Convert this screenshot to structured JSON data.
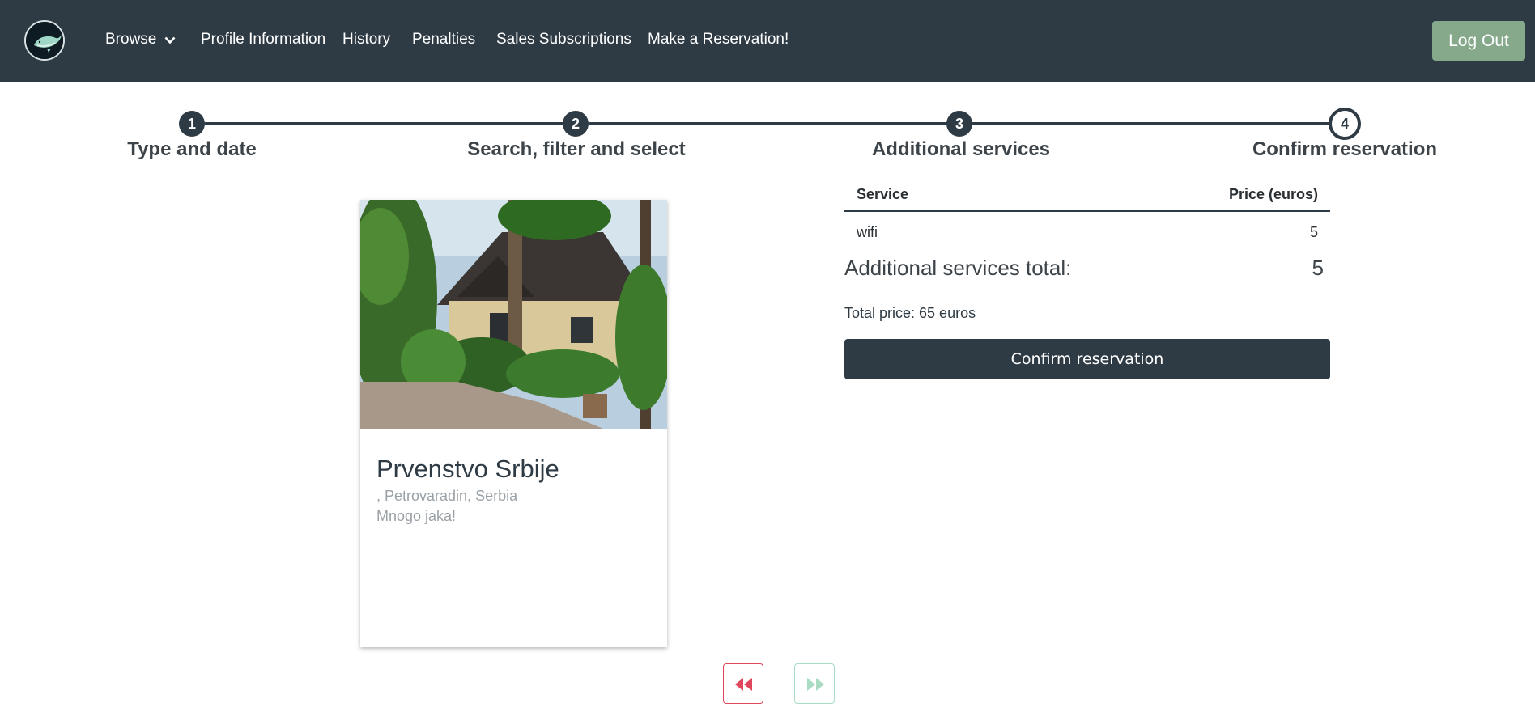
{
  "nav": {
    "logo_icon": "whale-logo-icon",
    "browse_label": "Browse",
    "browse_icon": "chevron-down-icon",
    "profile_label": "Profile Information",
    "history_label": "History",
    "penalties_label": "Penalties",
    "subscriptions_label": "Sales Subscriptions",
    "reservation_label": "Make a Reservation!",
    "logout_label": "Log Out"
  },
  "stepper": {
    "current_step": 4,
    "steps": [
      {
        "number": "1",
        "label": "Type and date"
      },
      {
        "number": "2",
        "label": "Search, filter and select"
      },
      {
        "number": "3",
        "label": "Additional services"
      },
      {
        "number": "4",
        "label": "Confirm reservation"
      }
    ]
  },
  "card": {
    "image_icon": "house-garden-photo",
    "title": "Prvenstvo Srbije",
    "address": ", Petrovaradin, Serbia",
    "description": "Mnogo jaka!"
  },
  "services": {
    "headers": {
      "service": "Service",
      "price": "Price (euros)"
    },
    "rows": [
      {
        "service": "wifi",
        "price": "5"
      }
    ],
    "additional_total_label": "Additional services total:",
    "additional_total_value": "5",
    "total_price": "Total price: 65 euros",
    "confirm_label": "Confirm reservation"
  },
  "pager": {
    "prev_icon": "fast-backward-icon",
    "next_icon": "fast-forward-icon"
  },
  "colors": {
    "navbar": "#2e3b45",
    "logout": "#85a98a",
    "prev_accent": "#e2465c",
    "next_accent": "#a9dcc2"
  }
}
